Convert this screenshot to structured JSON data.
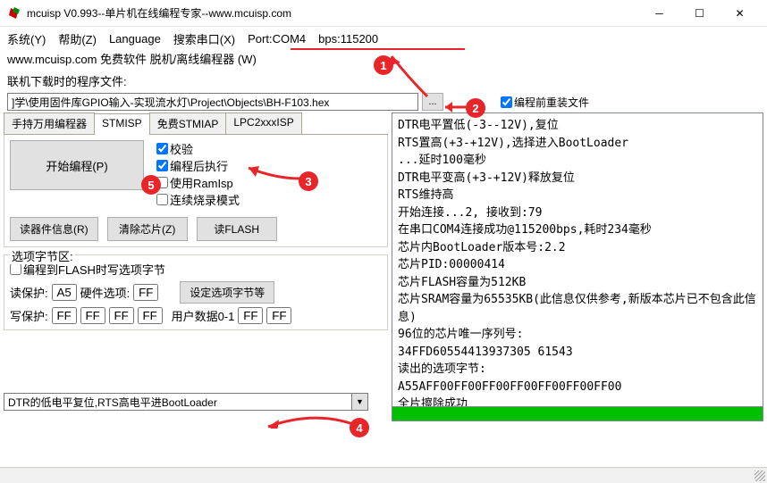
{
  "window": {
    "title": "mcuisp V0.993--单片机在线编程专家--www.mcuisp.com"
  },
  "menu": {
    "system": "系统(Y)",
    "help": "帮助(Z)",
    "language": "Language",
    "search_port": "搜索串口(X)",
    "port": "Port:COM4",
    "bps": "bps:115200"
  },
  "subtitle": "www.mcuisp.com 免费软件 脱机/离线编程器 (W)",
  "file_row": {
    "label": "联机下载时的程序文件:",
    "path": "]学\\使用固件库GPIO输入-实现流水灯\\Project\\Objects\\BH-F103.hex",
    "browse": "...",
    "reload": "编程前重装文件"
  },
  "tabs": {
    "t1": "手持万用编程器",
    "t2": "STMISP",
    "t3": "免费STMIAP",
    "t4": "LPC2xxxISP"
  },
  "stmisp": {
    "start": "开始编程(P)",
    "chk_verify": "校验",
    "chk_run": "编程后执行",
    "chk_ramisp": "使用RamIsp",
    "chk_continuous": "连续烧录模式",
    "btn_info": "读器件信息(R)",
    "btn_erase": "清除芯片(Z)",
    "btn_readflash": "读FLASH"
  },
  "optionbytes": {
    "legend": "选项字节区:",
    "write_option": "编程到FLASH时写选项字节",
    "read_protect": "读保护:",
    "read_protect_val": "A5",
    "hw_option": "硬件选项:",
    "hw_option_val": "FF",
    "set_option": "设定选项字节等",
    "write_protect": "写保护:",
    "wp0": "FF",
    "wp1": "FF",
    "wp2": "FF",
    "wp3": "FF",
    "user_data": "用户数据0-1",
    "ud0": "FF",
    "ud1": "FF"
  },
  "dtr_combo": "DTR的低电平复位,RTS高电平进BootLoader",
  "log": {
    "l1": "DTR电平置低(-3--12V),复位",
    "l2": "RTS置高(+3-+12V),选择进入BootLoader",
    "l3": "...延时100毫秒",
    "l4": "DTR电平变高(+3-+12V)释放复位",
    "l5": "RTS维持高",
    "l6": "开始连接...2, 接收到:79",
    "l7": "在串口COM4连接成功@115200bps,耗时234毫秒",
    "l8": "芯片内BootLoader版本号:2.2",
    "l9": "芯片PID:00000414",
    "l10": "芯片FLASH容量为512KB",
    "l11": "芯片SRAM容量为65535KB(此信息仅供参考,新版本芯片已不包含此信息)",
    "l12": "96位的芯片唯一序列号:",
    "l13": "34FFD60554413937305 61543",
    "l14": "读出的选项字节:",
    "l15": "A55AFF00FF00FF00FF00FF00FF00FF00",
    "l16": "全片擦除成功"
  }
}
